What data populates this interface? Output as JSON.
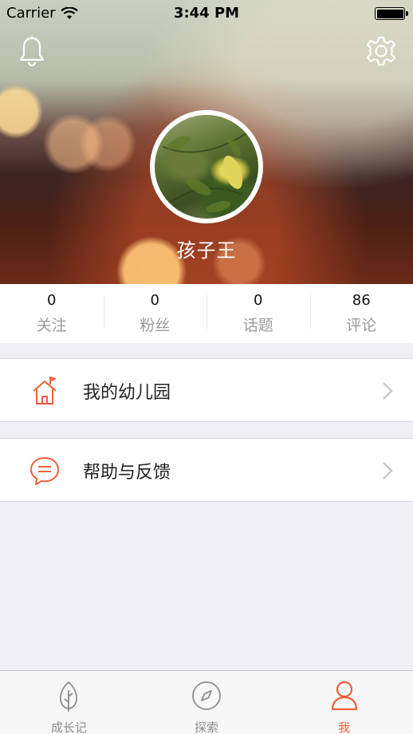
{
  "status_bar": {
    "carrier": "Carrier",
    "time": "3:44 PM",
    "battery_level": 1.0
  },
  "profile": {
    "username": "孩子王"
  },
  "stats": [
    {
      "count": "0",
      "label": "关注"
    },
    {
      "count": "0",
      "label": "粉丝"
    },
    {
      "count": "0",
      "label": "话题"
    },
    {
      "count": "86",
      "label": "评论"
    }
  ],
  "menu": [
    {
      "label": "我的幼儿园",
      "icon": "kindergarten-house-icon"
    },
    {
      "label": "帮助与反馈",
      "icon": "chat-bubble-icon"
    }
  ],
  "tabbar": {
    "items": [
      {
        "label": "成长记",
        "icon": "leaf-icon",
        "active": false
      },
      {
        "label": "探索",
        "icon": "compass-icon",
        "active": false
      },
      {
        "label": "我",
        "icon": "person-icon",
        "active": true
      }
    ]
  },
  "colors": {
    "accent": "#f0603a",
    "background": "#efeff4",
    "inactive": "#8e8e8e"
  }
}
